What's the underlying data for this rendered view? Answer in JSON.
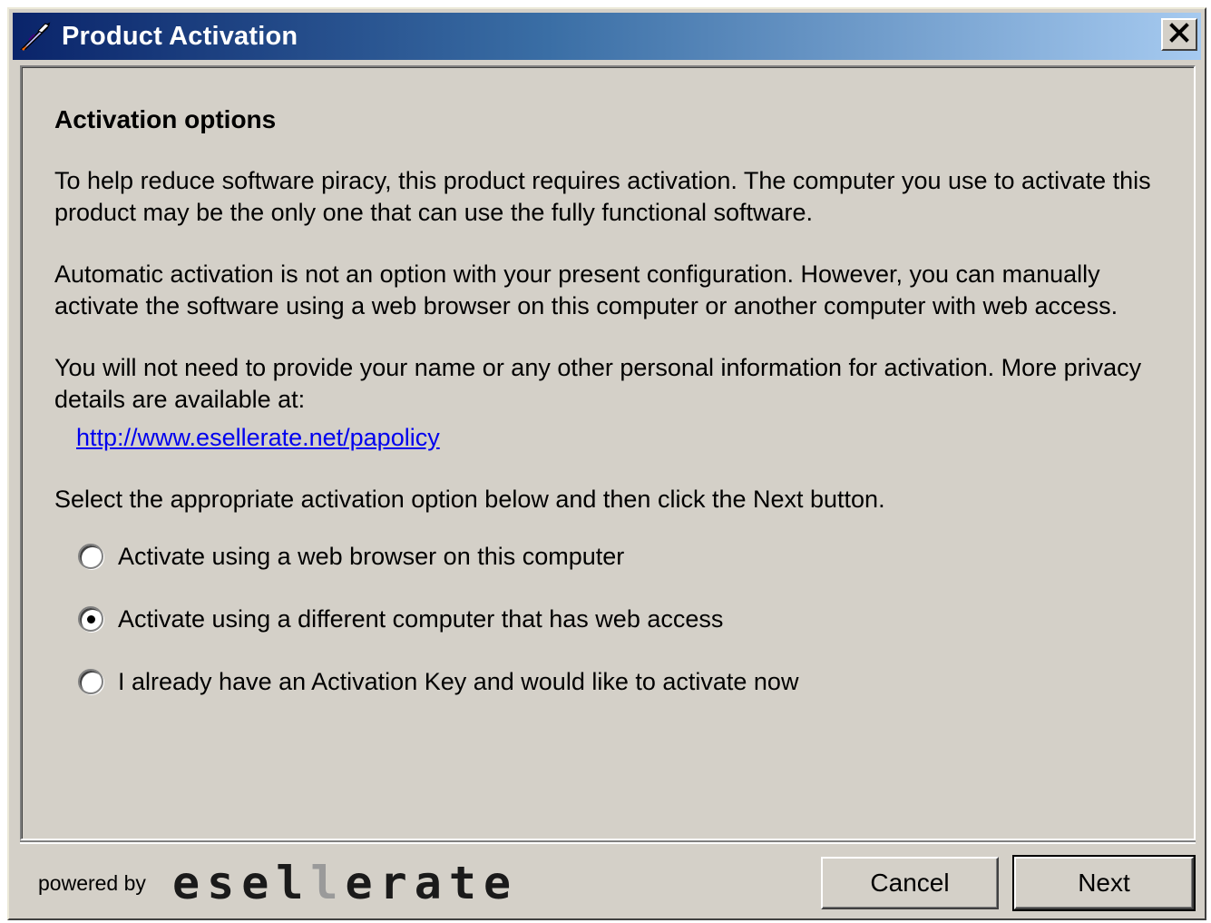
{
  "window": {
    "title": "Product Activation",
    "close_glyph": "✕"
  },
  "content": {
    "heading": "Activation options",
    "paragraph1": "To help reduce software piracy, this product requires activation. The computer you use to activate this product may be the only one that can use the fully functional software.",
    "paragraph2": "Automatic activation is not an option with your present configuration. However, you can manually activate the software using a web browser on this computer or another computer with web access.",
    "paragraph3": "You will not need to provide your name or any other personal information for activation. More privacy details are available at:",
    "privacy_link": "http://www.esellerate.net/papolicy",
    "instruction": "Select the appropriate activation option below and then click the Next button.",
    "options": [
      {
        "label": "Activate using a web browser on this computer",
        "checked": false
      },
      {
        "label": "Activate using a different computer that has web access",
        "checked": true
      },
      {
        "label": "I already have an Activation Key and would like to activate now",
        "checked": false
      }
    ]
  },
  "footer": {
    "powered_by": "powered by",
    "brand_part1": "esel",
    "brand_part2": "l",
    "brand_part3": "erate",
    "cancel_label": "Cancel",
    "next_label": "Next"
  },
  "colors": {
    "titlebar_start": "#0a246a",
    "titlebar_end": "#a6caf0",
    "dialog_bg": "#d4d0c8",
    "link": "#0000ee"
  },
  "icons": {
    "title_icon": "rocket-feather-icon",
    "close_icon": "close-icon"
  }
}
